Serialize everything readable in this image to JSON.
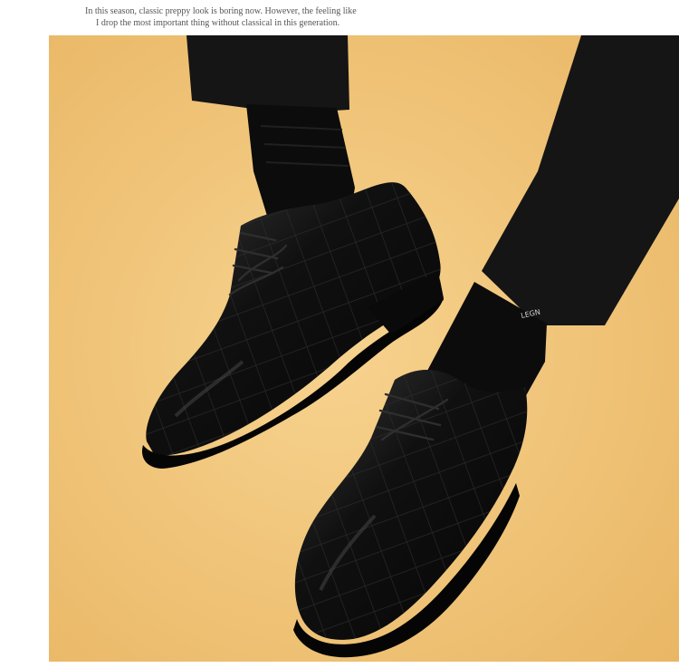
{
  "caption": {
    "line1": "In this season, classic preppy look is boring now. However, the feeling like",
    "line2": "I drop the most important thing without classical in this generation."
  },
  "photo": {
    "subject": "black-croc-pattern-oxford-shoes-icon",
    "background_color": "#f2c57a",
    "shoe_color": "#141414",
    "sock_color": "#0c0c0c",
    "trouser_color": "#151515"
  }
}
